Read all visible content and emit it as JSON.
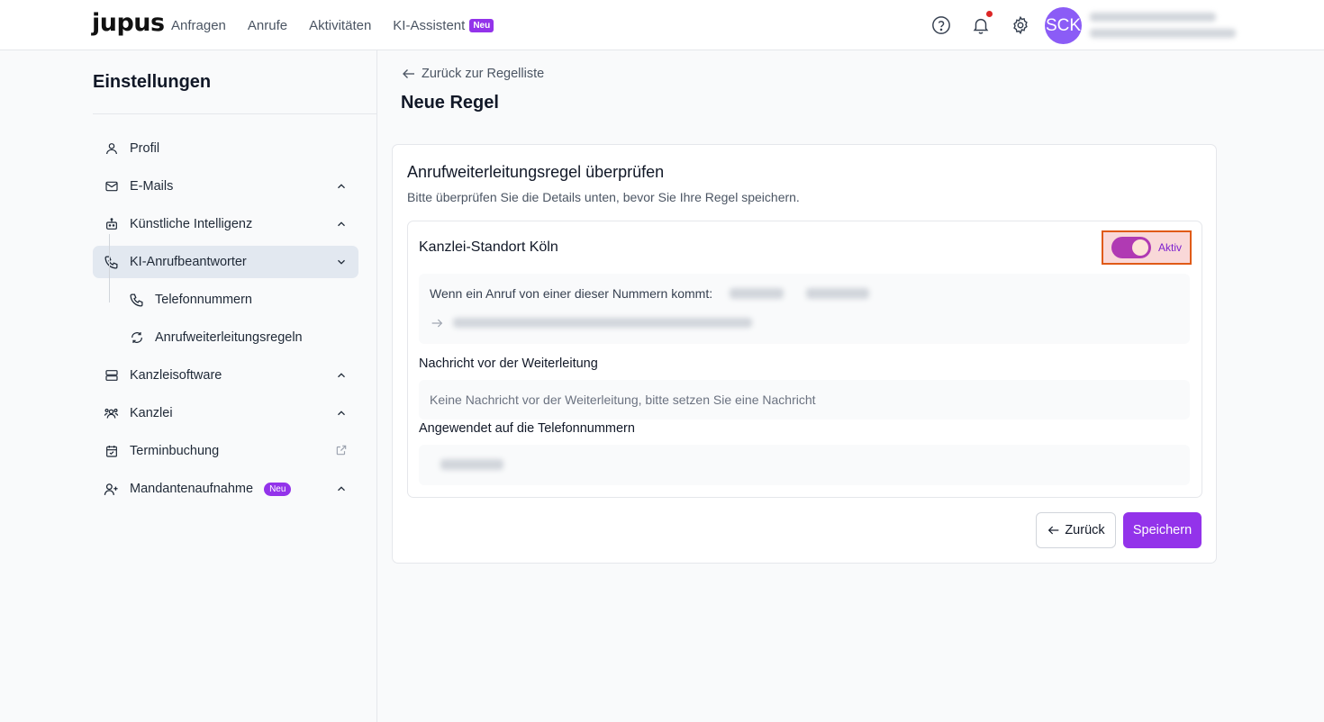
{
  "app": {
    "logo": "jupus"
  },
  "nav": {
    "items": [
      "Anfragen",
      "Anrufe",
      "Aktivitäten",
      "KI-Assistent"
    ],
    "new_badge": "Neu"
  },
  "header": {
    "avatar_initials": "SCK",
    "icons": [
      "help-icon",
      "bell-icon",
      "gear-icon"
    ]
  },
  "sidebar": {
    "title": "Einstellungen",
    "items": [
      {
        "label": "Profil",
        "icon": "user-icon"
      },
      {
        "label": "E-Mails",
        "icon": "mail-icon"
      },
      {
        "label": "Künstliche Intelligenz",
        "icon": "robot-icon"
      },
      {
        "label": "KI-Anrufbeantworter",
        "icon": "phone-icon"
      },
      {
        "label": "Telefonnummern",
        "icon": "phone-icon"
      },
      {
        "label": "Anrufweiterleitungsregeln",
        "icon": "refresh-icon"
      },
      {
        "label": "Kanzleisoftware",
        "icon": "server-icon"
      },
      {
        "label": "Kanzlei",
        "icon": "users-icon"
      },
      {
        "label": "Terminbuchung",
        "icon": "calendar-icon"
      },
      {
        "label": "Mandantenaufnahme",
        "icon": "user-plus-icon"
      }
    ],
    "new_badge": "Neu"
  },
  "main": {
    "back_link": "Zurück zur Regelliste",
    "title": "Neue Regel",
    "card": {
      "title": "Anrufweiterleitungsregel überprüfen",
      "subtitle": "Bitte überprüfen Sie die Details unten, bevor Sie Ihre Regel speichern.",
      "rule_name": "Kanzlei-Standort Köln",
      "toggle_label": "Aktiv",
      "toggle_on": true,
      "condition_text": "Wenn ein Anruf von einer dieser Nummern kommt:",
      "message_label": "Nachricht vor der Weiterleitung",
      "message_placeholder": "Keine Nachricht vor der Weiterleitung, bitte setzen Sie eine Nachricht",
      "applied_label": "Angewendet auf die Telefonnummern"
    },
    "buttons": {
      "back": "Zurück",
      "save": "Speichern"
    }
  },
  "colors": {
    "accent": "#9333ea",
    "toggle": "#b03ab3",
    "notification": "#dc2626",
    "avatar": "#8b5cf6"
  }
}
